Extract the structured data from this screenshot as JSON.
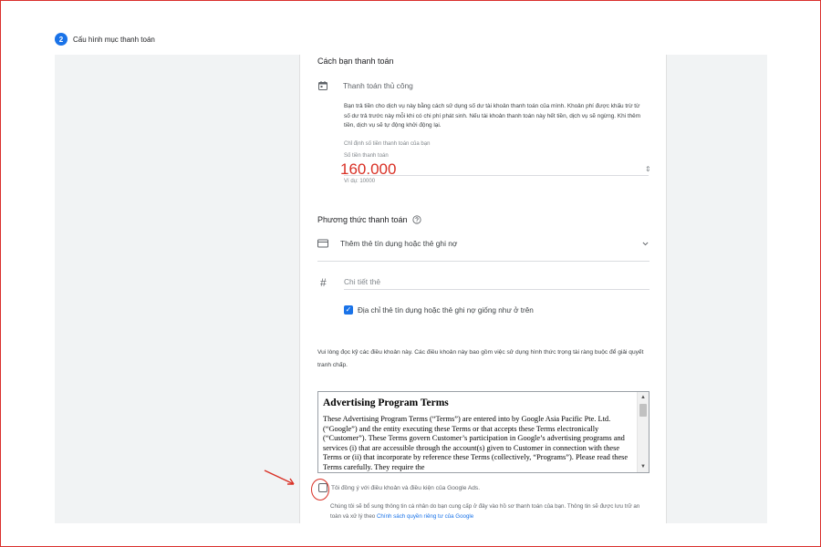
{
  "step": {
    "number": "2",
    "title": "Cấu hình mục thanh toán"
  },
  "payment": {
    "section_title": "Cách bạn thanh toán",
    "manual_label": "Thanh toán thủ công",
    "description": "Bạn trả tiền cho dịch vụ này bằng cách sử dụng số dư tài khoản thanh toán của mình. Khoản phí được khấu trừ từ số dư trả trước này mỗi khi có chi phí phát sinh. Nếu tài khoản thanh toán này hết tiền, dịch vụ sẽ ngừng. Khi thêm tiền, dịch vụ sẽ tự động khởi động lại.",
    "amount_hint": "Chỉ định số tiền thanh toán của bạn",
    "amount_label": "Số tiền thanh toán",
    "amount_value": "160.000",
    "amount_example": "Ví dụ: 10000"
  },
  "method": {
    "section_title": "Phương thức thanh toán",
    "add_card_label": "Thêm thẻ tín dụng hoặc thẻ ghi nợ",
    "card_details_placeholder": "Chi tiết thẻ",
    "same_address_label": "Địa chỉ thẻ tín dụng hoặc thẻ ghi nợ giống như ở trên"
  },
  "terms": {
    "notice": "Vui lòng đọc kỹ các điều khoản này. Các điều khoản này bao gồm việc sử dụng hình thức trọng tài ràng buộc để giải quyết tranh chấp.",
    "heading": "Advertising Program Terms",
    "body": "These Advertising Program Terms (“Terms”) are entered into by Google Asia Pacific Pte. Ltd. (“Google”) and the entity executing these Terms or that accepts these Terms electronically (“Customer”). These Terms govern Customer’s participation in Google’s advertising programs and services (i) that are accessible through the account(s) given to Customer in connection with these Terms or (ii) that incorporate by reference these Terms (collectively, “Programs”). Please read these Terms carefully. They require the",
    "agree_label": "Tôi đồng ý với điều khoản và điều kiện của Google Ads.",
    "privacy_text": "Chúng tôi sẽ bổ sung thông tin cá nhân do bạn cung cấp ở đây vào hồ sơ thanh toán của bạn. Thông tin sẽ được lưu trữ an toàn và xử lý theo",
    "privacy_link": "Chính sách quyền riêng tư của Google"
  },
  "colors": {
    "accent": "#1a73e8",
    "annotation": "#d93025"
  },
  "icons": {
    "calendar": "calendar-icon",
    "card": "credit-card-icon",
    "hash": "hash-icon",
    "help": "help-circle-icon",
    "chevron": "chevron-down-icon"
  }
}
